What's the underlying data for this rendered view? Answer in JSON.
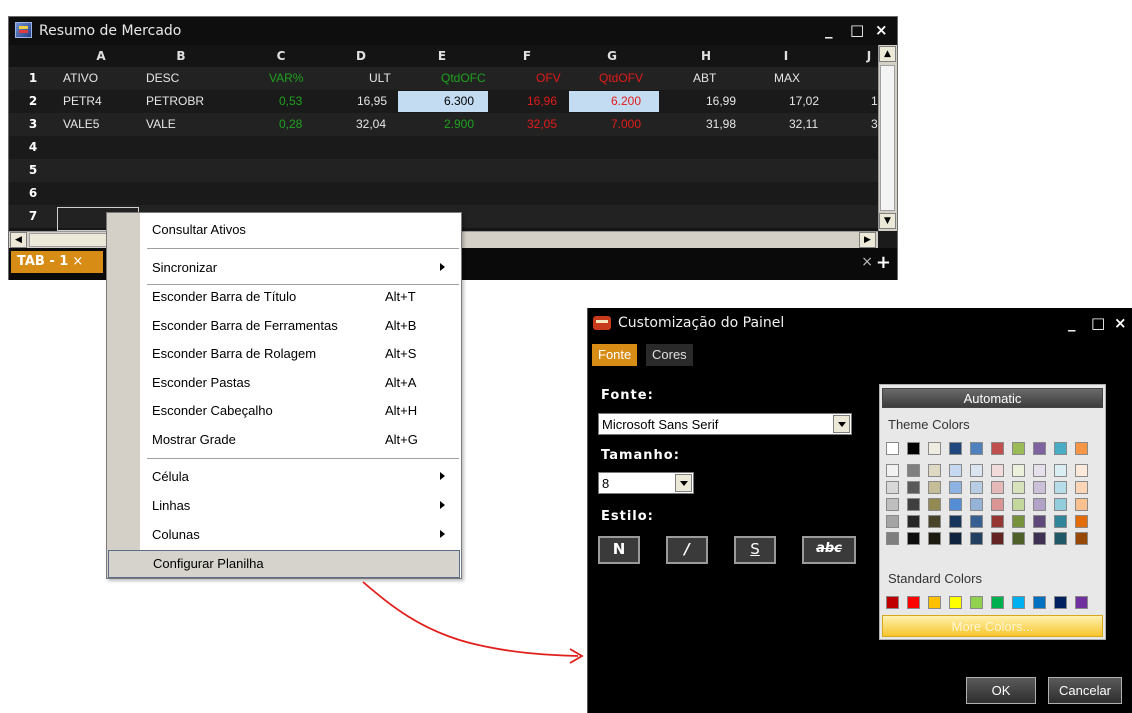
{
  "sheet": {
    "title": "Resumo de Mercado",
    "columns": [
      "A",
      "B",
      "C",
      "D",
      "E",
      "F",
      "G",
      "H",
      "I",
      "J"
    ],
    "rows": [
      {
        "num": "1",
        "cells": [
          "ATIVO",
          "DESC",
          "VAR%",
          "ULT",
          "QtdOFC",
          "OFV",
          "QtdOFV",
          "ABT",
          "MAX",
          ""
        ]
      },
      {
        "num": "2",
        "cells": [
          "PETR4",
          "PETROBR",
          "0,53",
          "16,95",
          "6.300",
          "16,96",
          "6.200",
          "16,99",
          "17,02",
          "1"
        ]
      },
      {
        "num": "3",
        "cells": [
          "VALE5",
          "VALE",
          "0,28",
          "32,04",
          "2.900",
          "32,05",
          "7.000",
          "31,98",
          "32,11",
          "3"
        ]
      },
      {
        "num": "4",
        "cells": []
      },
      {
        "num": "5",
        "cells": []
      },
      {
        "num": "6",
        "cells": []
      },
      {
        "num": "7",
        "cells": []
      }
    ],
    "tab_label": "TAB - 1",
    "tab_close": "×",
    "add_tab": "+",
    "close_tabs": "×",
    "win_minimize": "_",
    "win_maximize": "□",
    "win_close": "×"
  },
  "menu": {
    "items": [
      {
        "label": "Consultar Ativos",
        "shortcut": ""
      },
      {
        "label": "Sincronizar",
        "shortcut": ""
      },
      {
        "label": "Esconder Barra de Título",
        "shortcut": "Alt+T"
      },
      {
        "label": "Esconder Barra de Ferramentas",
        "shortcut": "Alt+B"
      },
      {
        "label": "Esconder Barra de Rolagem",
        "shortcut": "Alt+S"
      },
      {
        "label": "Esconder Pastas",
        "shortcut": "Alt+A"
      },
      {
        "label": "Esconder Cabeçalho",
        "shortcut": "Alt+H"
      },
      {
        "label": "Mostrar Grade",
        "shortcut": "Alt+G"
      },
      {
        "label": "Célula",
        "shortcut": ""
      },
      {
        "label": "Linhas",
        "shortcut": ""
      },
      {
        "label": "Colunas",
        "shortcut": ""
      },
      {
        "label": "Configurar Planilha",
        "shortcut": ""
      }
    ]
  },
  "dialog": {
    "title": "Customização do Painel",
    "tabs": [
      "Fonte",
      "Cores"
    ],
    "font_label": "Fonte:",
    "font_value": "Microsoft Sans Serif",
    "size_label": "Tamanho:",
    "size_value": "8",
    "style_label": "Estilo:",
    "style_buttons": [
      "N",
      "/",
      "S",
      "abc"
    ],
    "picker": {
      "automatic": "Automatic",
      "theme_label": "Theme Colors",
      "standard_label": "Standard Colors",
      "more": "More Colors...",
      "theme_top": [
        "#ffffff",
        "#000000",
        "#eeece1",
        "#1f497d",
        "#4f81bd",
        "#c0504d",
        "#9bbb59",
        "#8064a2",
        "#4bacc6",
        "#f79646"
      ],
      "theme_shades": [
        [
          "#f2f2f2",
          "#d8d8d8",
          "#bfbfbf",
          "#a5a5a5",
          "#7f7f7f"
        ],
        [
          "#7f7f7f",
          "#595959",
          "#3f3f3f",
          "#262626",
          "#0c0c0c"
        ],
        [
          "#ddd9c3",
          "#c4bd97",
          "#938953",
          "#494429",
          "#1d1b10"
        ],
        [
          "#c6d9f0",
          "#8db3e2",
          "#548dd4",
          "#17365d",
          "#0f243e"
        ],
        [
          "#dbe5f1",
          "#b8cce4",
          "#95b3d7",
          "#366092",
          "#244061"
        ],
        [
          "#f2dcdb",
          "#e5b9b7",
          "#d99694",
          "#953734",
          "#632423"
        ],
        [
          "#ebf1dd",
          "#d7e3bc",
          "#c3d69b",
          "#76923c",
          "#4f6128"
        ],
        [
          "#e5e0ec",
          "#ccc1d9",
          "#b2a2c7",
          "#5f497a",
          "#3f3151"
        ],
        [
          "#dbeef3",
          "#b7dde8",
          "#92cddc",
          "#31859b",
          "#205867"
        ],
        [
          "#fdeada",
          "#fbd5b5",
          "#fac08f",
          "#e36c09",
          "#974806"
        ]
      ],
      "standard": [
        "#c00000",
        "#ff0000",
        "#ffc000",
        "#ffff00",
        "#92d050",
        "#00b050",
        "#00b0f0",
        "#0070c0",
        "#002060",
        "#7030a0"
      ]
    },
    "ok": "OK",
    "cancel": "Cancelar",
    "win_minimize": "_",
    "win_maximize": "□",
    "win_close": "×"
  },
  "colors": {
    "accent_orange": "#d78c16",
    "positive_green": "#1ea21e",
    "negative_red": "#e21b1b",
    "highlight_blue": "#c3dcf2",
    "arrow_red": "#e0201c"
  }
}
